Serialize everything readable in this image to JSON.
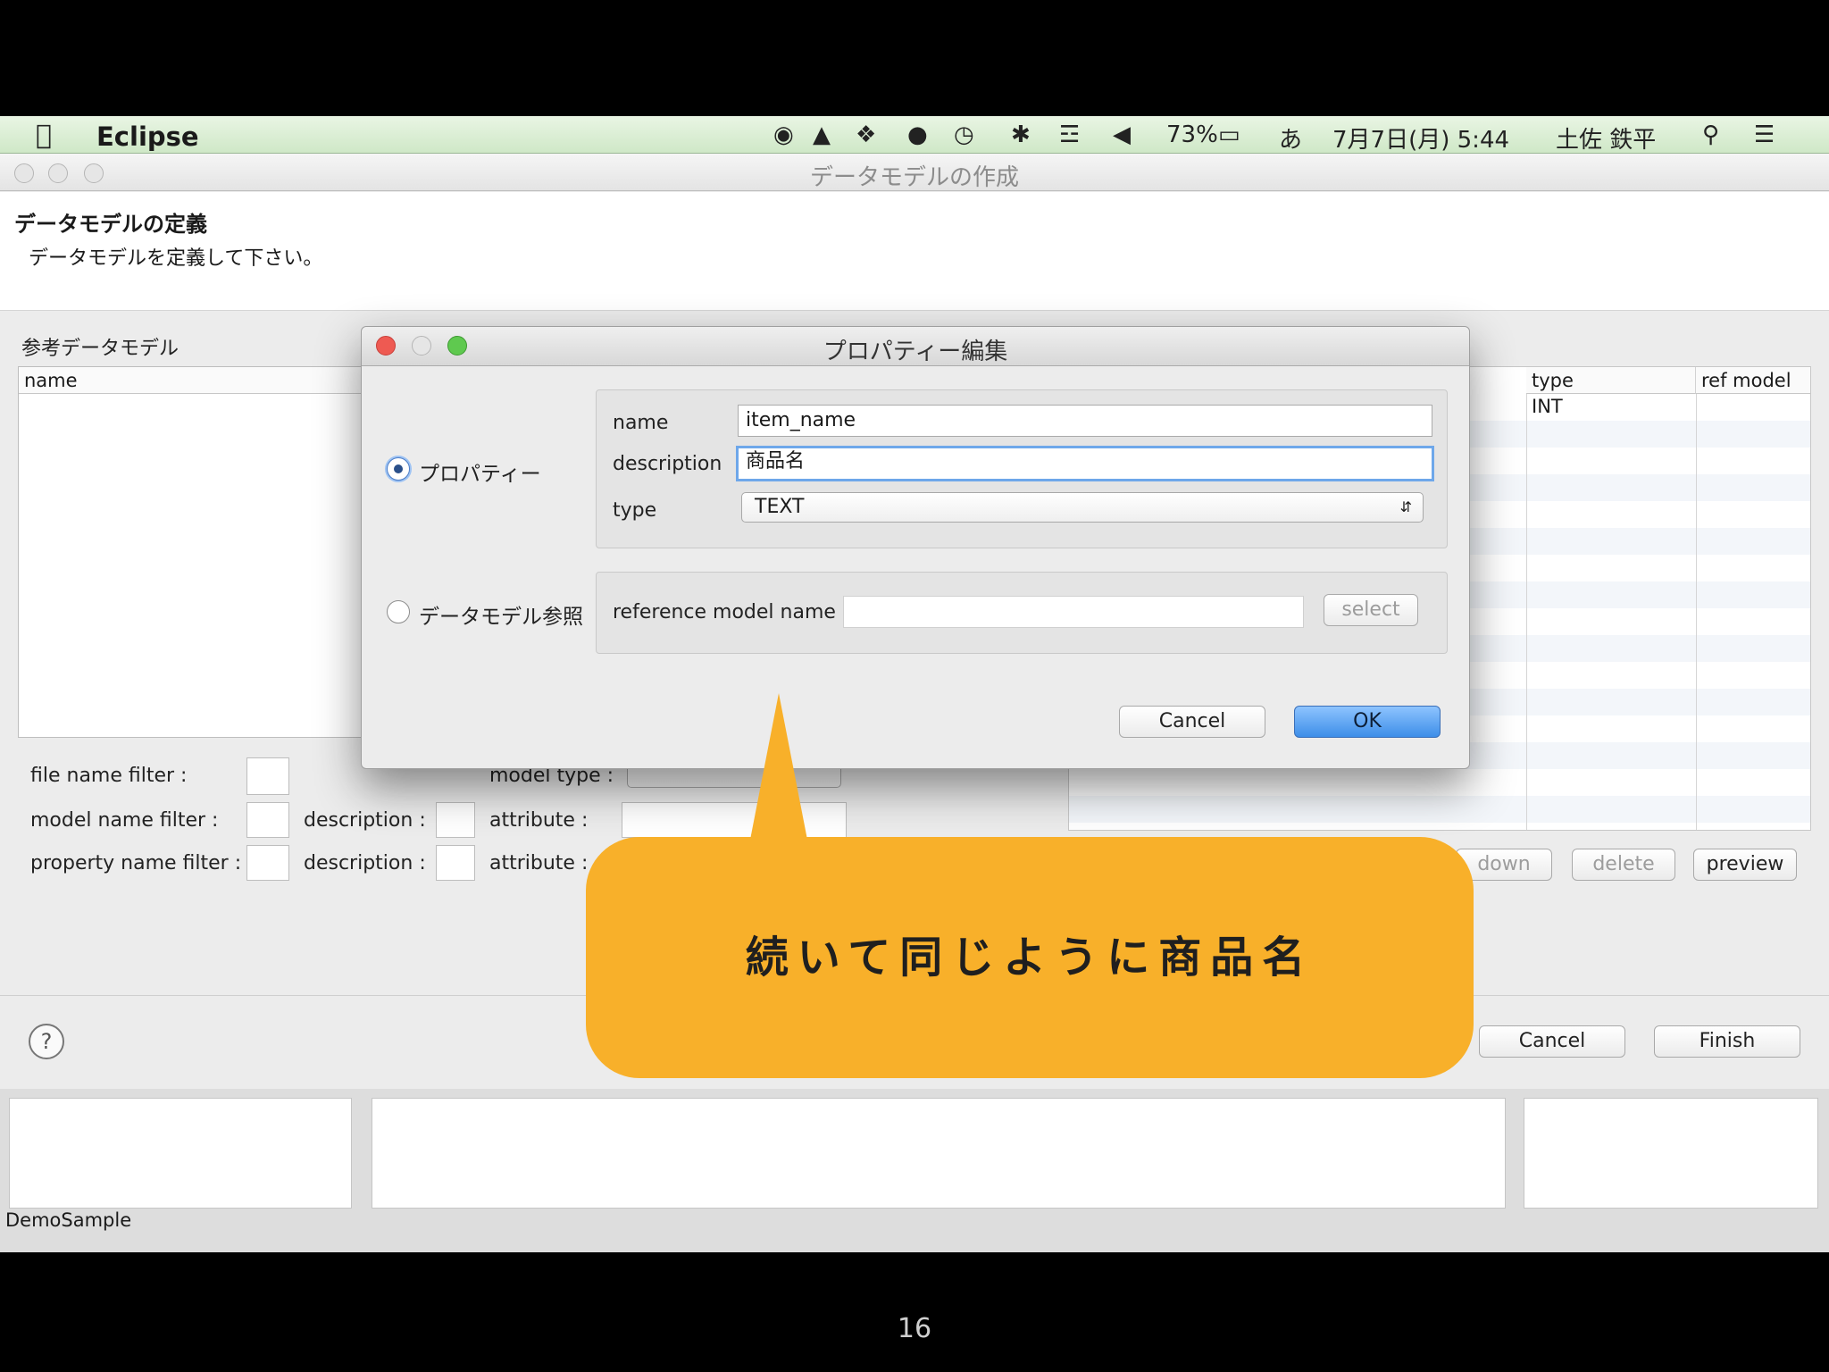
{
  "menubar": {
    "app_name": "Eclipse",
    "battery": "73%",
    "input_method": "あ",
    "datetime": "7月7日(月) 5:44",
    "user": "土佐 鉄平"
  },
  "window": {
    "title": "データモデルの作成",
    "heading": "データモデルの定義",
    "subheading": "データモデルを定義して下さい。",
    "reference_section": "参考データモデル",
    "left_table_header": "name",
    "right_table_headers": [
      "type",
      "ref model"
    ],
    "right_table_rows": [
      {
        "type": "INT",
        "ref": ""
      }
    ],
    "filters": {
      "file_name_filter": "file name filter :",
      "model_type": "model type :",
      "model_name_filter": "model name filter :",
      "description1": "description :",
      "attribute1": "attribute :",
      "property_name_filter": "property name filter :",
      "description2": "description :",
      "attribute2": "attribute :"
    },
    "row_buttons": {
      "down": "down",
      "delete": "delete",
      "preview": "preview"
    },
    "footer_buttons": {
      "cancel": "Cancel",
      "finish": "Finish"
    },
    "status": "DemoSample"
  },
  "dialog": {
    "title": "プロパティー編集",
    "radio_property": "プロパティー",
    "radio_reference": "データモデル参照",
    "name_label": "name",
    "name_value": "item_name",
    "description_label": "description",
    "description_value": "商品名",
    "type_label": "type",
    "type_value": "TEXT",
    "reference_label": "reference model name",
    "reference_value": "",
    "select_button": "select",
    "cancel": "Cancel",
    "ok": "OK"
  },
  "callout": {
    "text": "続いて同じように商品名"
  },
  "slide_number": "16",
  "colors": {
    "callout": "#f8b02a",
    "menubar": "#d8eed1",
    "ok_button": "#3d8ee8"
  }
}
